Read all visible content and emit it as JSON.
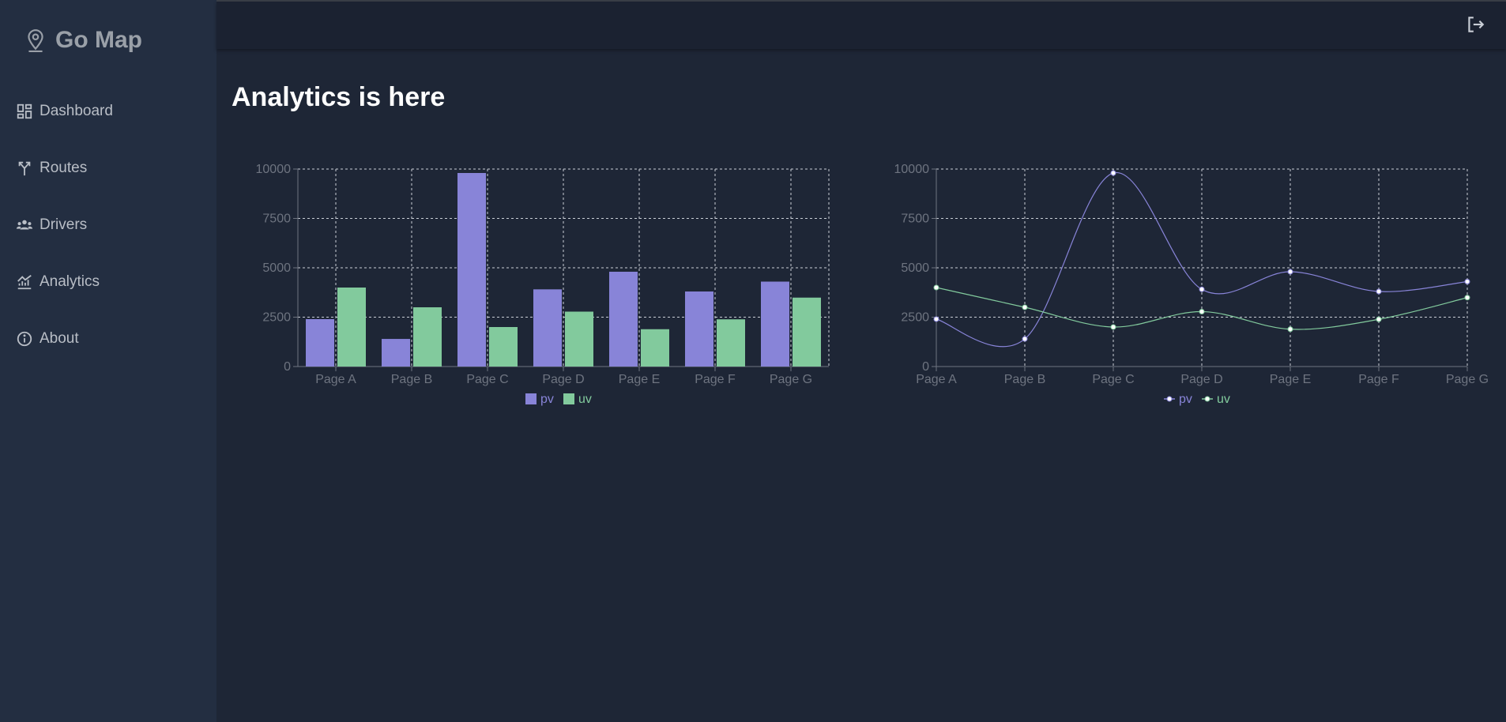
{
  "app": {
    "title": "Go Map"
  },
  "sidebar": {
    "items": [
      {
        "label": "Dashboard",
        "icon": "dashboard-icon"
      },
      {
        "label": "Routes",
        "icon": "routes-icon"
      },
      {
        "label": "Drivers",
        "icon": "drivers-icon"
      },
      {
        "label": "Analytics",
        "icon": "analytics-icon"
      },
      {
        "label": "About",
        "icon": "info-icon"
      }
    ]
  },
  "header": {
    "logout_icon": "logout-icon"
  },
  "main": {
    "title": "Analytics is here"
  },
  "colors": {
    "pv": "#8884d8",
    "uv": "#82ca9d",
    "grid": "#c9ced6",
    "tick": "#6e7480"
  },
  "chart_data": [
    {
      "type": "bar",
      "categories": [
        "Page A",
        "Page B",
        "Page C",
        "Page D",
        "Page E",
        "Page F",
        "Page G"
      ],
      "series": [
        {
          "name": "pv",
          "values": [
            2400,
            1398,
            9800,
            3908,
            4800,
            3800,
            4300
          ]
        },
        {
          "name": "uv",
          "values": [
            4000,
            3000,
            2000,
            2780,
            1890,
            2390,
            3490
          ]
        }
      ],
      "yticks": [
        0,
        2500,
        5000,
        7500,
        10000
      ],
      "ylim": [
        0,
        10000
      ],
      "grid": true,
      "legend": "bottom-center"
    },
    {
      "type": "line",
      "categories": [
        "Page A",
        "Page B",
        "Page C",
        "Page D",
        "Page E",
        "Page F",
        "Page G"
      ],
      "series": [
        {
          "name": "pv",
          "values": [
            2400,
            1398,
            9800,
            3908,
            4800,
            3800,
            4300
          ]
        },
        {
          "name": "uv",
          "values": [
            4000,
            3000,
            2000,
            2780,
            1890,
            2390,
            3490
          ]
        }
      ],
      "yticks": [
        0,
        2500,
        5000,
        7500,
        10000
      ],
      "ylim": [
        0,
        10000
      ],
      "grid": true,
      "legend": "bottom-center"
    }
  ]
}
